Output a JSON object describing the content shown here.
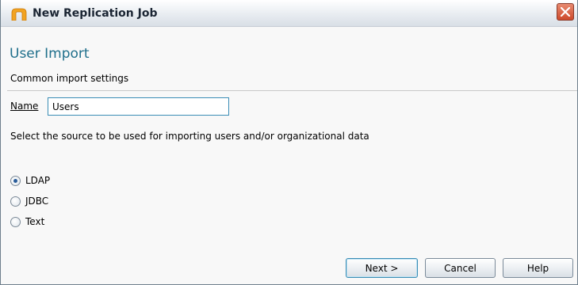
{
  "window": {
    "title": "New Replication Job",
    "close_icon": "close-icon"
  },
  "header": {
    "title": "User Import",
    "subtitle": "Common import settings"
  },
  "form": {
    "name_label": "Name",
    "name_value": "Users",
    "source_description": "Select the source to be used for importing users and/or organizational data",
    "sources": [
      {
        "label": "LDAP",
        "selected": true
      },
      {
        "label": "JDBC",
        "selected": false
      },
      {
        "label": "Text",
        "selected": false
      }
    ]
  },
  "buttons": {
    "next": "Next >",
    "cancel": "Cancel",
    "help": "Help"
  },
  "colors": {
    "title_accent": "#1f6f8b",
    "close_button": "#cd4a2b",
    "focus_border": "#3a8db5"
  }
}
